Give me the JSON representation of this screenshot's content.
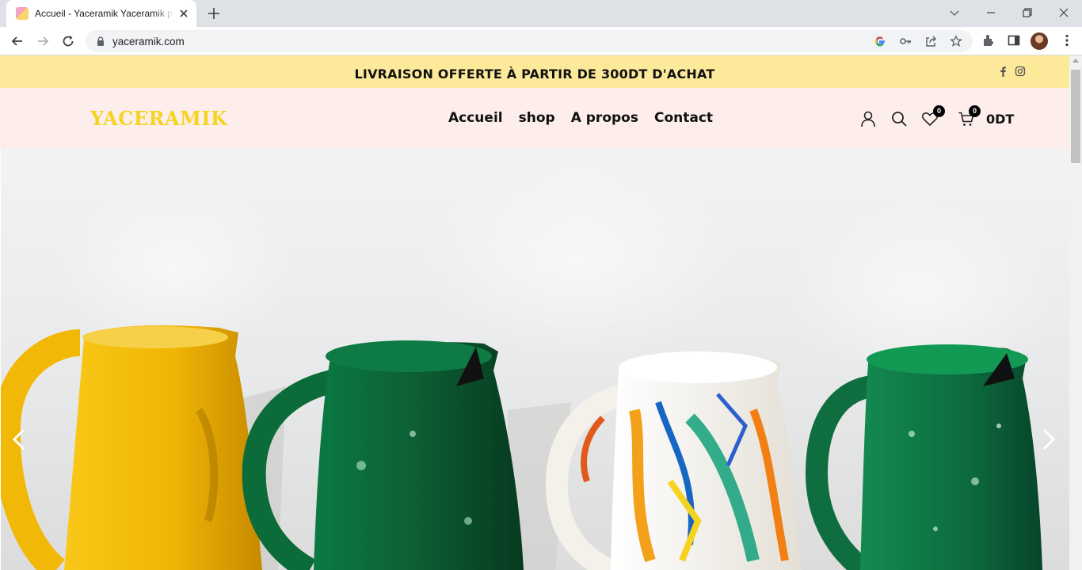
{
  "browser": {
    "tab_title": "Accueil - Yaceramik Yaceramik pr",
    "url": "yaceramik.com"
  },
  "topbar": {
    "promo_text": "LIVRAISON OFFERTE À PARTIR DE 300DT D'ACHAT",
    "social_icons": [
      "facebook-icon",
      "instagram-icon"
    ]
  },
  "header": {
    "logo": "YACERAMIK",
    "nav": [
      "Accueil",
      "shop",
      "A propos",
      "Contact"
    ],
    "wishlist_count": "0",
    "cart_count": "0",
    "cart_total": "0DT"
  },
  "hero": {
    "product_colors": [
      "#f2b807",
      "#0d6b3b",
      "#f6f3ec",
      "#127347"
    ]
  }
}
